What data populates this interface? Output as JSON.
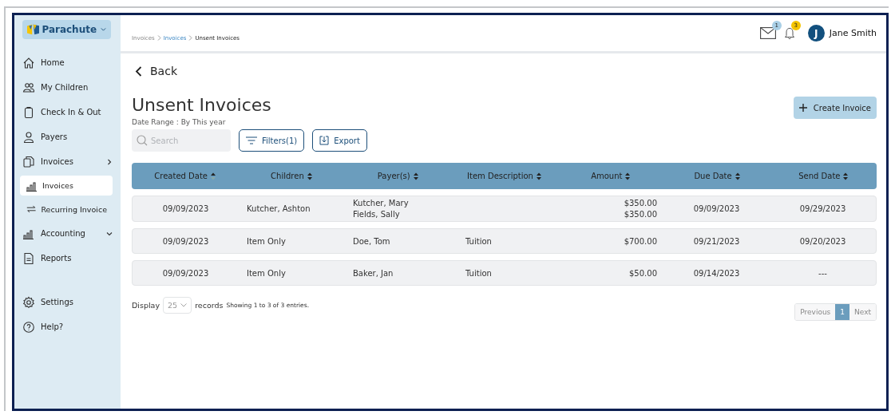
{
  "logo": {
    "name": "Parachute"
  },
  "sidebar": {
    "items": [
      {
        "label": "Home",
        "kind": "main",
        "selected": false
      },
      {
        "label": "My Children",
        "kind": "main",
        "selected": false
      },
      {
        "label": "Check In & Out",
        "kind": "main",
        "selected": false
      },
      {
        "label": "Payers",
        "kind": "main",
        "selected": false
      },
      {
        "label": "Invoices",
        "kind": "group",
        "expanded": true,
        "selected": false
      },
      {
        "label": "Invoices",
        "kind": "sub",
        "selected": true
      },
      {
        "label": "Recurring Invoice",
        "kind": "sub",
        "selected": false
      },
      {
        "label": "Accounting",
        "kind": "group",
        "expanded": false,
        "selected": false
      },
      {
        "label": "Reports",
        "kind": "main",
        "selected": false
      }
    ],
    "bottom": [
      {
        "label": "Settings"
      },
      {
        "label": "Help?"
      }
    ]
  },
  "breadcrumb": [
    {
      "label": "Invoices",
      "kind": "plain"
    },
    {
      "label": "Invoices",
      "kind": "link"
    },
    {
      "label": "Unsent Invoices",
      "kind": "current"
    }
  ],
  "header": {
    "mail_count": "1",
    "bell_count": "3",
    "avatar": "J",
    "user": "Jane Smith"
  },
  "back": "Back",
  "title": "Unsent Invoices",
  "date_range": "Date Range : By This year",
  "create_button": "Create Invoice",
  "search": {
    "placeholder": "Search"
  },
  "filters_button": "Filters(1)",
  "export_button": "Export",
  "table": {
    "columns": [
      "Created Date",
      "Children",
      "Payer(s)",
      "Item Description",
      "Amount",
      "Due Date",
      "Send Date"
    ],
    "rows": [
      {
        "created": "09/09/2023",
        "children": "Kutcher, Ashton",
        "payers": [
          "Kutcher, Mary",
          "Fields, Sally"
        ],
        "item": "",
        "amounts": [
          "$350.00",
          "$350.00"
        ],
        "due": "09/09/2023",
        "send": "09/29/2023"
      },
      {
        "created": "09/09/2023",
        "children": "Item Only",
        "payers": [
          "Doe, Tom"
        ],
        "item": "Tuition",
        "amounts": [
          "$700.00"
        ],
        "due": "09/21/2023",
        "send": "09/20/2023"
      },
      {
        "created": "09/09/2023",
        "children": "Item Only",
        "payers": [
          "Baker, Jan"
        ],
        "item": "Tuition",
        "amounts": [
          "$50.00"
        ],
        "due": "09/14/2023",
        "send": "---"
      }
    ]
  },
  "footer": {
    "display": "Display",
    "page_size": "25",
    "records": "records",
    "showing": "Showing 1 to 3 of 3 entries."
  },
  "pagination": [
    {
      "label": "Previous",
      "selected": false
    },
    {
      "label": "1",
      "selected": true
    },
    {
      "label": "Next",
      "selected": false
    }
  ]
}
